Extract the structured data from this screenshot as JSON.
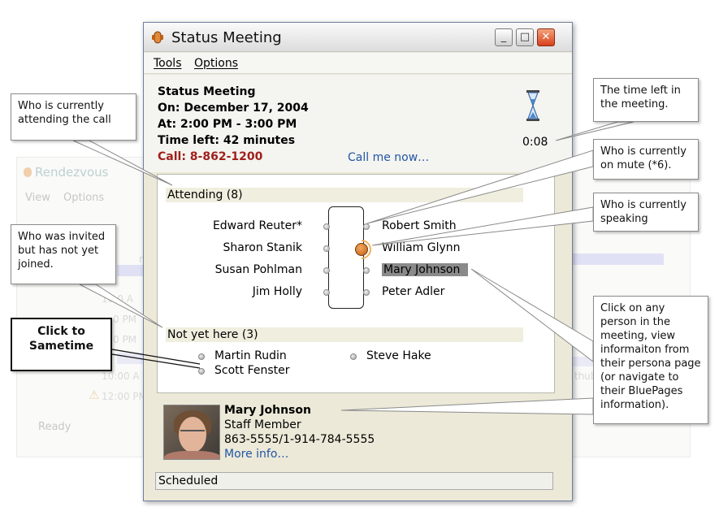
{
  "background_window": {
    "title": "Rendezvous",
    "menu": [
      "View",
      "Options"
    ],
    "status": "Ready",
    "faded_texts": [
      "rsd",
      "10:0 A",
      "0 PM",
      "0 PM",
      "10:00 A",
      "12:00 PM",
      "thub"
    ]
  },
  "window": {
    "title": "Status Meeting",
    "controls": {
      "minimize": "_",
      "maximize": "□",
      "close": "✕"
    },
    "menu": {
      "tools": "Tools",
      "options": "Options"
    }
  },
  "meeting": {
    "title": "Status Meeting",
    "date": "On: December 17, 2004",
    "time": "At: 2:00 PM - 3:00 PM",
    "time_left": "Time left: 42 minutes",
    "call": "Call: 8-862-1200",
    "call_me_link": "Call me now…",
    "timer": "0:08"
  },
  "attending": {
    "header": "Attending (8)",
    "left": [
      "Edward Reuter*",
      "Sharon Stanik",
      "Susan Pohlman",
      "Jim Holly"
    ],
    "right": [
      "Robert Smith",
      "William Glynn",
      "Mary Johnson",
      "Peter Adler"
    ]
  },
  "not_yet_here": {
    "header": "Not yet here (3)",
    "people": [
      "Martin Rudin",
      "Steve Hake",
      "Scott Fenster"
    ]
  },
  "profile": {
    "name": "Mary Johnson",
    "role": "Staff Member",
    "phone": "863-5555/1-914-784-5555",
    "more": "More info…"
  },
  "status_bar": "Scheduled",
  "callouts": {
    "attending": "Who is currently attending the call",
    "invited": "Who was invited but has not yet joined.",
    "time": "The time left in the meeting.",
    "mute": "Who is currently on mute (*6).",
    "speaking": "Who is currently speaking",
    "click": "Click on any person in the meeting, view informaiton from their persona page (or navigate to their BluePages information).",
    "sametime": "Click to Sametime"
  },
  "colors": {
    "call_red": "#a0201c",
    "link_blue": "#2255a4",
    "speaker_orange": "#c25e10",
    "selected_gray": "#8a8a8a"
  }
}
